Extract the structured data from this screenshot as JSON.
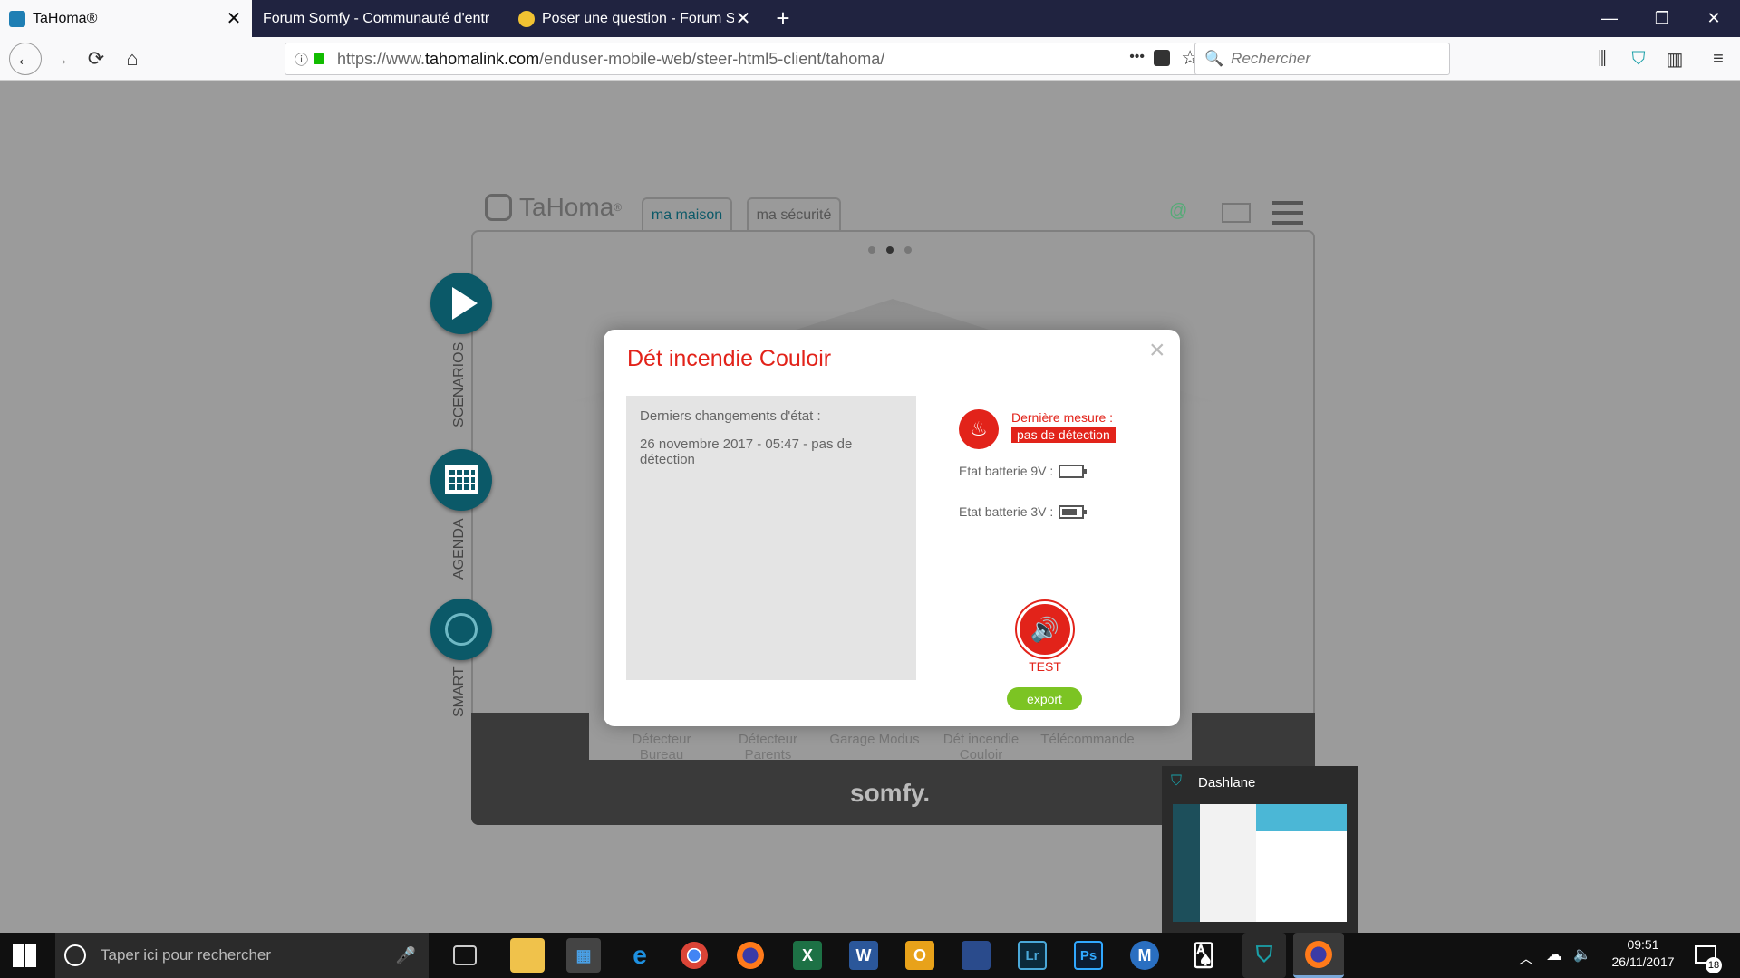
{
  "browser": {
    "tabs": [
      {
        "label": "TaHoma®",
        "active": true
      },
      {
        "label": "Forum Somfy - Communauté d'entr",
        "active": false
      },
      {
        "label": "Poser une question - Forum Sor",
        "active": false
      }
    ],
    "new_tab": "+",
    "url_scheme": "https://www.",
    "url_domain": "tahomalink.com",
    "url_path": "/enduser-mobile-web/steer-html5-client/tahoma/",
    "search_placeholder": "Rechercher",
    "dots": "•••"
  },
  "app": {
    "logo": "TaHoma",
    "logo_mark": "®",
    "tabs": [
      "ma maison",
      "ma sécurité"
    ],
    "side_labels": [
      "SCENARIOS",
      "AGENDA",
      "SMART"
    ],
    "devices": [
      "Détecteur Bureau",
      "Détecteur Parents",
      "Garage Modus",
      "Dét incendie Couloir",
      "Télécommande"
    ],
    "footer_brand": "somfy."
  },
  "modal": {
    "title": "Dét incendie Couloir",
    "history_title": "Derniers changements d'état :",
    "history_entry": "26 novembre 2017 - 05:47 - pas de détection",
    "last_measure_label": "Dernière mesure :",
    "last_measure_value": "pas de détection",
    "battery_9v": "Etat batterie 9V :",
    "battery_3v": "Etat batterie 3V :",
    "test_label": "TEST",
    "export_label": "export",
    "close": "×"
  },
  "popup": {
    "title": "Dashlane"
  },
  "taskbar": {
    "search_placeholder": "Taper ici pour rechercher",
    "time": "09:51",
    "date": "26/11/2017",
    "notification_count": "18"
  },
  "colors": {
    "accent_red": "#e2231a",
    "tahoma_teal": "#0b5968",
    "export_green": "#7cc423"
  }
}
